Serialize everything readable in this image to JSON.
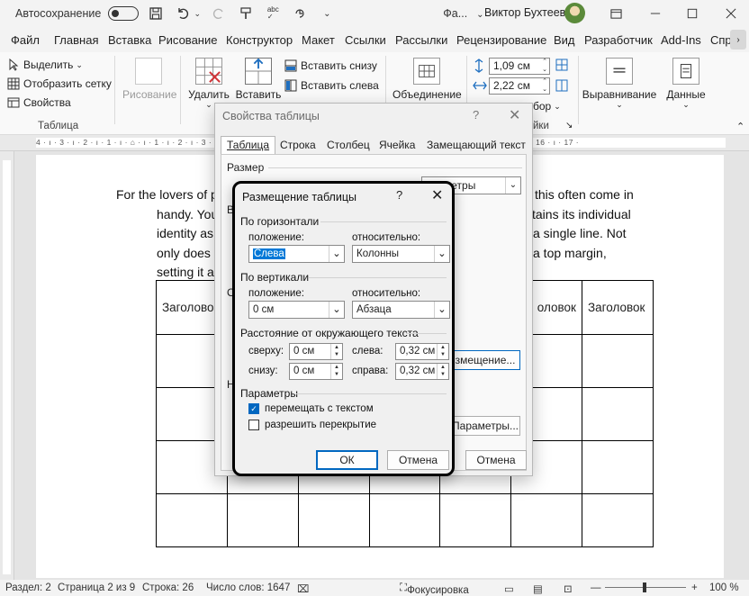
{
  "titlebar": {
    "autosave_label": "Автосохранение",
    "filename": "Фа...",
    "user_name": "Виктор Бухтеев"
  },
  "tabs": [
    "Файл",
    "Главная",
    "Вставка",
    "Рисование",
    "Конструктор",
    "Макет",
    "Ссылки",
    "Рассылки",
    "Рецензирование",
    "Вид",
    "Разработчик",
    "Add-Ins",
    "Спр"
  ],
  "ribbon": {
    "select": "Выделить",
    "show_grid": "Отобразить сетку",
    "properties": "Свойства",
    "group_table": "Таблица",
    "draw": "Рисование",
    "delete": "Удалить",
    "insert": "Вставить",
    "insert_below": "Вставить снизу",
    "insert_left": "Вставить слева",
    "merge": "Объединение",
    "height_value": "1,09 см",
    "width_value": "2,22 см",
    "cell_size_group": "йки",
    "autofit_fragment": "бор",
    "align": "Выравнивание",
    "data": "Данные"
  },
  "ruler_numbers": "4 · ı · 3 · ı · 2 · ı · 1 · ı · ⌂ · ı · 1 · ı · 2 · ı · 3 · ı · 4 · ı · 5 · ı · 6 · ı · 7 · ı · 8 · ı · 9 · ı · 10 · ı · 11 · ı · 12 · ı · 13 · ı · 14 · ı · 15 · ı · 16 · ı · 17 ·",
  "document": {
    "line1_left": "For the lovers of p",
    "line1_right": "this often come in",
    "line2_left": "handy. You",
    "line2_right": "tains its individual",
    "line3_left": "identity as",
    "line3_right": "a single line. Not",
    "line4_left": "only does t",
    "line4_right": "a top margin,",
    "line5_left": "setting it a",
    "header_left": "Заголовок",
    "header_right1": "оловок",
    "header_right2": "Заголовок"
  },
  "status": {
    "section": "Раздел: 2",
    "page": "Страница 2 из 9",
    "line": "Строка: 26",
    "words": "Число слов: 1647",
    "focus": "Фокусировка",
    "zoom": "100 %"
  },
  "table_properties": {
    "title": "Свойства таблицы",
    "tabs": [
      "Таблица",
      "Строка",
      "Столбец",
      "Ячейка",
      "Замещающий текст"
    ],
    "size_label": "Размер",
    "params_fragment": "метры",
    "placement_button": "змещение...",
    "params_button": "Параметры...",
    "cancel_button": "Отмена"
  },
  "positioning": {
    "title": "Размещение таблицы",
    "horizontal": "По горизонтали",
    "position": "положение:",
    "relative": "относительно:",
    "h_position_value": "Слева",
    "h_relative_value": "Колонны",
    "vertical": "По вертикали",
    "v_position_value": "0 см",
    "v_relative_value": "Абзаца",
    "distance": "Расстояние от окружающего текста",
    "top": "сверху:",
    "top_value": "0 см",
    "left": "слева:",
    "left_value": "0,32 см",
    "bottom": "снизу:",
    "bottom_value": "0 см",
    "right": "справа:",
    "right_value": "0,32 см",
    "options": "Параметры",
    "move_with_text": "перемещать с текстом",
    "allow_overlap": "разрешить перекрытие",
    "ok": "ОК",
    "cancel": "Отмена",
    "move_with_text_checked": true,
    "allow_overlap_checked": false
  }
}
